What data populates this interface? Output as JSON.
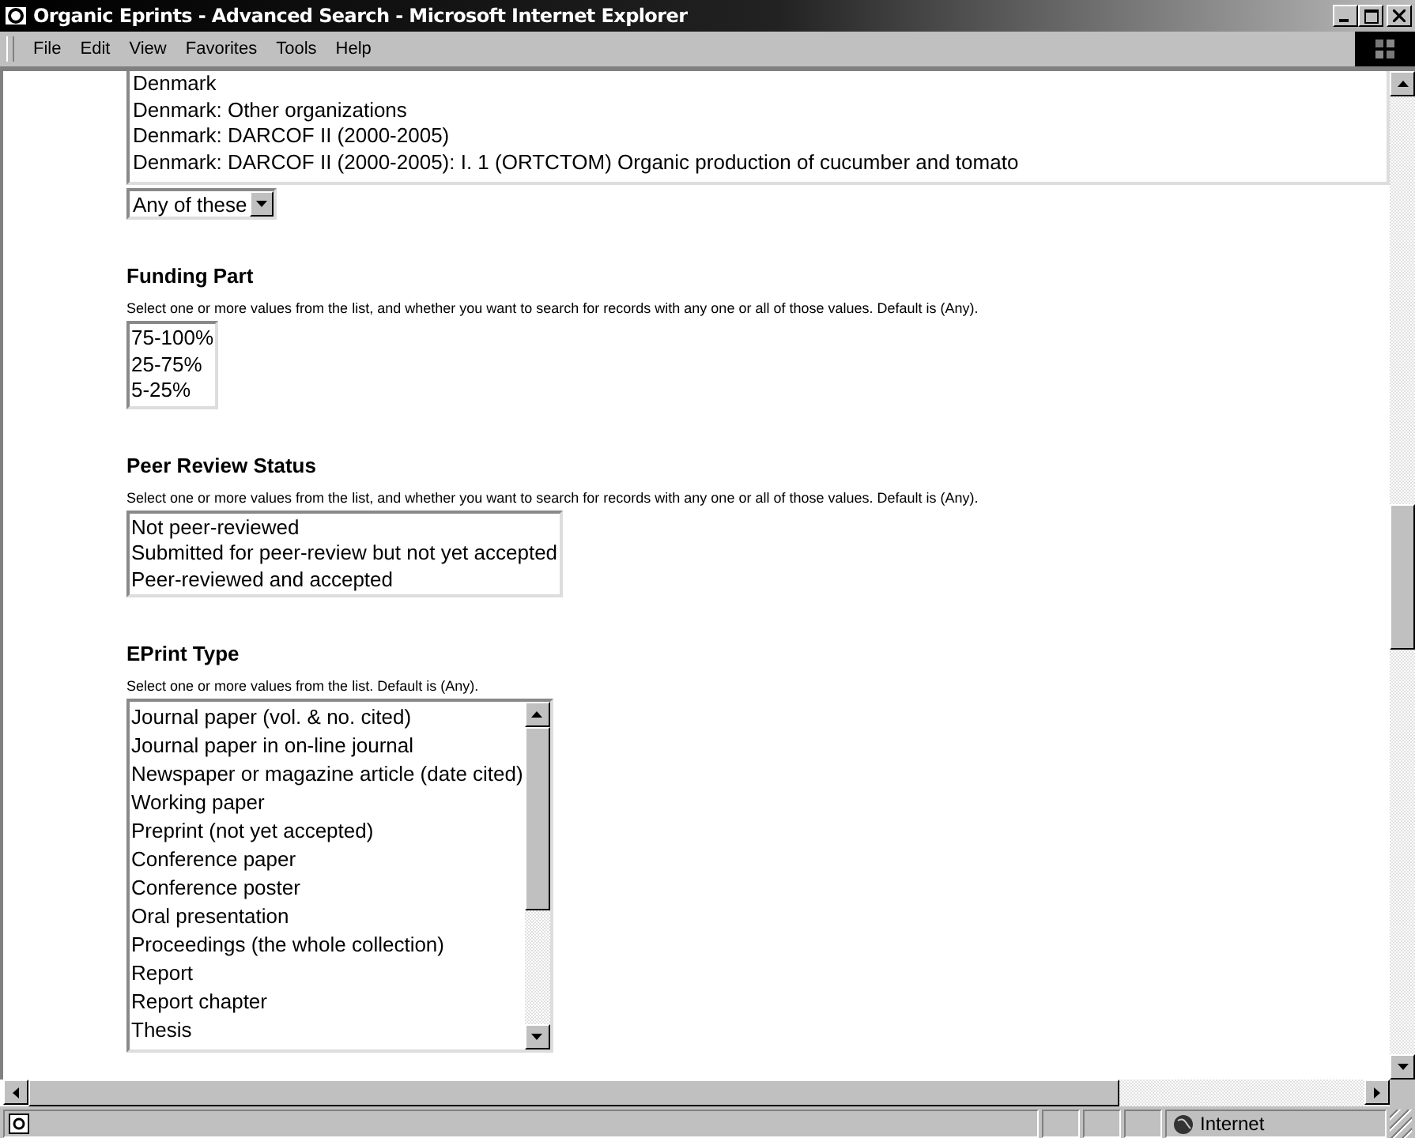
{
  "window": {
    "title": "Organic Eprints - Advanced Search - Microsoft Internet Explorer"
  },
  "menu": [
    "File",
    "Edit",
    "View",
    "Favorites",
    "Tools",
    "Help"
  ],
  "top_list": {
    "options": [
      "Denmark",
      "Denmark: Other organizations",
      "Denmark: DARCOF II (2000-2005)",
      "Denmark: DARCOF II (2000-2005): I. 1 (ORTCTOM) Organic production of cucumber and tomato"
    ],
    "match": "Any of these"
  },
  "sections": [
    {
      "heading": "Funding Part",
      "hint": "Select one or more values from the list, and whether you want to search for records with any one or all of those values. Default is (Any).",
      "options": [
        "75-100%",
        "25-75%",
        "5-25%"
      ],
      "scrollable": false
    },
    {
      "heading": "Peer Review Status",
      "hint": "Select one or more values from the list, and whether you want to search for records with any one or all of those values. Default is (Any).",
      "options": [
        "Not peer-reviewed",
        "Submitted for peer-review but not yet accepted",
        "Peer-reviewed and accepted"
      ],
      "scrollable": false
    },
    {
      "heading": "EPrint Type",
      "hint": "Select one or more values from the list. Default is (Any).",
      "options": [
        "Journal paper (vol. & no. cited)",
        "Journal paper in on-line journal",
        "Newspaper or magazine article (date cited)",
        "Working paper",
        "Preprint (not yet accepted)",
        "Conference paper",
        "Conference poster",
        "Oral presentation",
        "Proceedings (the whole collection)",
        "Report",
        "Report chapter",
        "Thesis"
      ],
      "scrollable": true
    }
  ],
  "status_bar": {
    "zone": "Internet"
  }
}
